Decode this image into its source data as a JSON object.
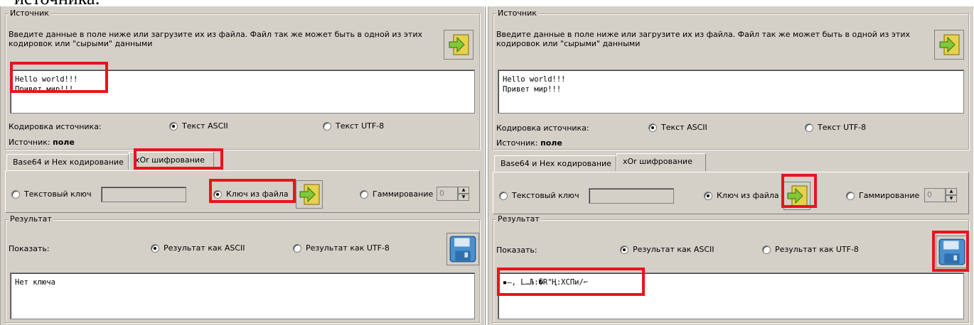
{
  "caption": "источника:",
  "source": {
    "group_title": "Источник",
    "description": "Введите данные в поле ниже или загрузите их из файла. Файл так же может быть в одной из этих кодировок или \"сырыми\" данными",
    "text_lines": [
      "Hello world!!!",
      "Привет мир!!!"
    ],
    "encoding_label": "Кодировка источника:",
    "encoding_options": [
      "Текст ASCII",
      "Текст UTF-8"
    ],
    "selected_encoding": "Текст ASCII",
    "source_label": "Источник:",
    "source_value": "поле"
  },
  "tabs": [
    "Base64 и Hex кодирование",
    "xOr шифрование"
  ],
  "active_tab": "xOr шифрование",
  "xor": {
    "text_key_label": "Текстовый ключ",
    "file_key_label": "Ключ из файла",
    "gamma_label": "Гаммирование",
    "gamma_value": "0",
    "selected": "Ключ из файла"
  },
  "result": {
    "group_title": "Результат",
    "show_label": "Показать:",
    "options": [
      "Результат как ASCII",
      "Результат как UTF-8"
    ],
    "selected": "Результат как ASCII",
    "left_output": "Нет ключа",
    "right_output": "▪—‚ L…Љ:�R\"Ң:XСПи/⌐"
  },
  "colors": {
    "highlight": "#e8141c",
    "panel": "#d4d0c8"
  },
  "icons": {
    "load": "arrow-in-icon",
    "save": "floppy-disk-icon"
  }
}
